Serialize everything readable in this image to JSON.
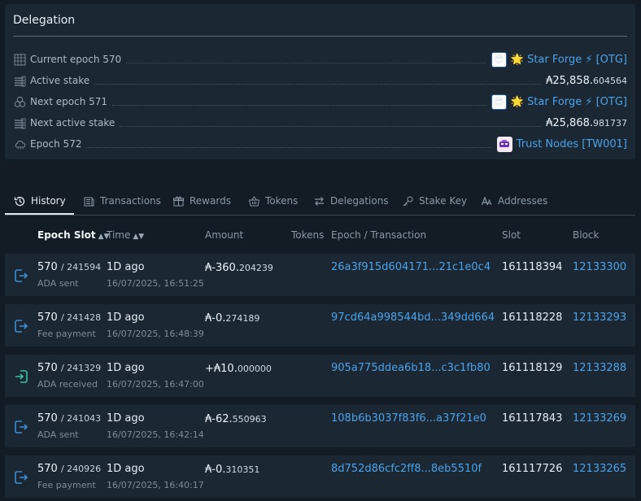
{
  "delegation": {
    "title": "Delegation",
    "rows": [
      {
        "label": "Current epoch 570",
        "icon": "epoch-grid-icon",
        "pool_name": "🌟 Star Forge ⚡ [OTG]"
      },
      {
        "label": "Active stake",
        "icon": "stake-stack-icon",
        "amount_int": "₳25,858.",
        "amount_dec": "604564"
      },
      {
        "label": "Next epoch 571",
        "icon": "next-epoch-icon",
        "pool_name": "🌟 Star Forge ⚡ [OTG]"
      },
      {
        "label": "Next active stake",
        "icon": "stake-stack-icon",
        "amount_int": "₳25,868.",
        "amount_dec": "981737"
      },
      {
        "label": "Epoch 572",
        "icon": "cloud-icon",
        "pool_name": "Trust Nodes [TW001]"
      }
    ]
  },
  "tabs": [
    {
      "label": "History",
      "icon": "history-icon",
      "active": true
    },
    {
      "label": "Transactions",
      "icon": "transactions-icon"
    },
    {
      "label": "Rewards",
      "icon": "gift-icon"
    },
    {
      "label": "Tokens",
      "icon": "basket-icon"
    },
    {
      "label": "Delegations",
      "icon": "swap-arrows-icon"
    },
    {
      "label": "Stake Key",
      "icon": "key-icon"
    },
    {
      "label": "Addresses",
      "icon": "font-icon"
    }
  ],
  "table": {
    "columns": [
      "Epoch Slot",
      "Time",
      "Amount",
      "Tokens",
      "Epoch / Transaction",
      "Slot",
      "Block"
    ],
    "sorted_column": "Epoch Slot",
    "rows": [
      {
        "epoch": "570",
        "slot": "/ 241594",
        "type": "ADA sent",
        "direction": "out",
        "ago": "1D ago",
        "timestamp": "16/07/2025, 16:51:25",
        "amount_int": "₳-360.",
        "amount_dec": "204239",
        "tx": "26a3f915d604171...21c1e0c4",
        "slot_num": "161118394",
        "block": "12133300"
      },
      {
        "epoch": "570",
        "slot": "/ 241428",
        "type": "Fee payment",
        "direction": "out",
        "ago": "1D ago",
        "timestamp": "16/07/2025, 16:48:39",
        "amount_int": "₳-0.",
        "amount_dec": "274189",
        "tx": "97cd64a998544bd...349dd664",
        "slot_num": "161118228",
        "block": "12133293"
      },
      {
        "epoch": "570",
        "slot": "/ 241329",
        "type": "ADA received",
        "direction": "in",
        "ago": "1D ago",
        "timestamp": "16/07/2025, 16:47:00",
        "amount_int": "+₳10.",
        "amount_dec": "000000",
        "tx": "905a775ddea6b18...c3c1fb80",
        "slot_num": "161118129",
        "block": "12133288"
      },
      {
        "epoch": "570",
        "slot": "/ 241043",
        "type": "ADA sent",
        "direction": "out",
        "ago": "1D ago",
        "timestamp": "16/07/2025, 16:42:14",
        "amount_int": "₳-62.",
        "amount_dec": "550963",
        "tx": "108b6b3037f83f6...a37f21e0",
        "slot_num": "161117843",
        "block": "12133269"
      },
      {
        "epoch": "570",
        "slot": "/ 240926",
        "type": "Fee payment",
        "direction": "out",
        "ago": "1D ago",
        "timestamp": "16/07/2025, 16:40:17",
        "amount_int": "₳-0.",
        "amount_dec": "310351",
        "tx": "8d752d86cfc2ff8...8eb5510f",
        "slot_num": "161117726",
        "block": "12133265"
      }
    ]
  },
  "colors": {
    "background": "#131b24",
    "panel": "#1b2733",
    "link": "#4aa3ea",
    "outgoing": "#3b8fd6",
    "incoming": "#36c2a0"
  }
}
